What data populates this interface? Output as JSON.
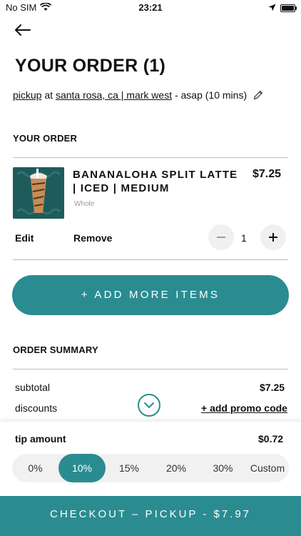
{
  "status_bar": {
    "carrier": "No SIM",
    "time": "23:21"
  },
  "header": {
    "title": "YOUR ORDER (1)"
  },
  "pickup": {
    "mode": "pickup",
    "at": "at",
    "location": "santa rosa, ca | mark west",
    "timing": "- asap (10 mins)"
  },
  "order_section": {
    "heading": "YOUR ORDER",
    "item": {
      "name": "BANANALOHA SPLIT LATTE | ICED | MEDIUM",
      "price": "$7.25",
      "option": "Whole",
      "edit_label": "Edit",
      "remove_label": "Remove",
      "quantity": "1"
    },
    "add_more_label": "+ ADD MORE ITEMS"
  },
  "summary": {
    "heading": "ORDER SUMMARY",
    "subtotal_label": "subtotal",
    "subtotal_value": "$7.25",
    "discounts_label": "discounts",
    "promo_label": "+ add promo code"
  },
  "tip": {
    "label": "tip amount",
    "value": "$0.72",
    "options": [
      "0%",
      "10%",
      "15%",
      "20%",
      "30%",
      "Custom"
    ],
    "selected": "10%"
  },
  "checkout": {
    "label": "CHECKOUT – PICKUP - $7.97"
  },
  "colors": {
    "accent": "#2a8c91",
    "divider": "#bdbdbd"
  }
}
